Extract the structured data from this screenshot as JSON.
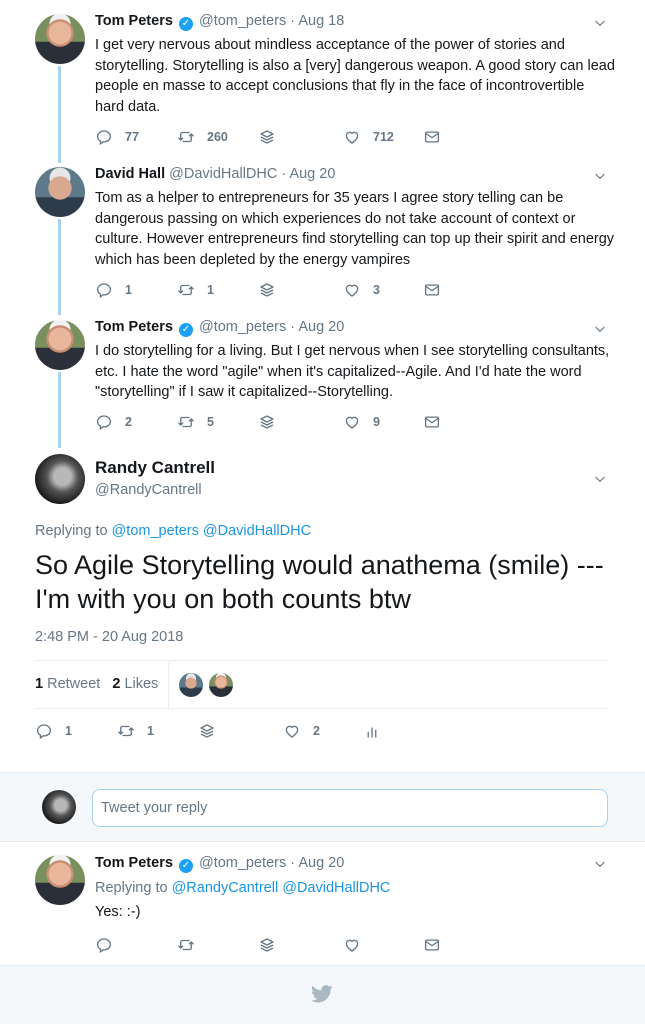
{
  "tweets": [
    {
      "name": "Tom Peters",
      "verified": true,
      "handle": "@tom_peters",
      "date": "Aug 18",
      "text": "I get very nervous about mindless acceptance of the power of stories and storytelling. Storytelling is also a [very] dangerous weapon. A good story can lead people en masse to accept conclusions that fly in the face of incontrovertible hard data.",
      "replies": "77",
      "retweets": "260",
      "likes": "712"
    },
    {
      "name": "David Hall",
      "verified": false,
      "handle": "@DavidHallDHC",
      "date": "Aug 20",
      "text": "Tom as a helper to entrepreneurs for 35 years I agree story telling can be dangerous passing on which experiences do not take account of context or culture. However entrepreneurs find storytelling can top up their spirit and energy which has been depleted by the energy vampires",
      "replies": "1",
      "retweets": "1",
      "likes": "3"
    },
    {
      "name": "Tom Peters",
      "verified": true,
      "handle": "@tom_peters",
      "date": "Aug 20",
      "text": "I do storytelling for a living. But I get nervous when I see storytelling consultants, etc. I hate the word \"agile\" when it's capitalized--Agile. And I'd hate the word \"storytelling\" if I saw it capitalized--Storytelling.",
      "replies": "2",
      "retweets": "5",
      "likes": "9"
    }
  ],
  "main_tweet": {
    "name": "Randy Cantrell",
    "handle": "@RandyCantrell",
    "replying_label": "Replying to",
    "replying_to": [
      "@tom_peters",
      "@DavidHallDHC"
    ],
    "text": "So Agile Storytelling would anathema (smile) --- I'm with you on both counts btw",
    "timestamp": "2:48 PM - 20 Aug 2018",
    "retweet_count": "1",
    "retweet_label": "Retweet",
    "like_count": "2",
    "like_label": "Likes",
    "replies": "1",
    "retweets": "1",
    "likes": "2"
  },
  "reply_box": {
    "placeholder": "Tweet your reply"
  },
  "last_tweet": {
    "name": "Tom Peters",
    "verified": true,
    "handle": "@tom_peters",
    "date": "Aug 20",
    "replying_label": "Replying to",
    "replying_to": [
      "@RandyCantrell",
      "@DavidHallDHC"
    ],
    "text": "Yes: :-)"
  },
  "colors": {
    "accent": "#1da1f2",
    "link": "#1b95e0",
    "muted": "#657786",
    "thread_line": "#a6d3f2"
  }
}
